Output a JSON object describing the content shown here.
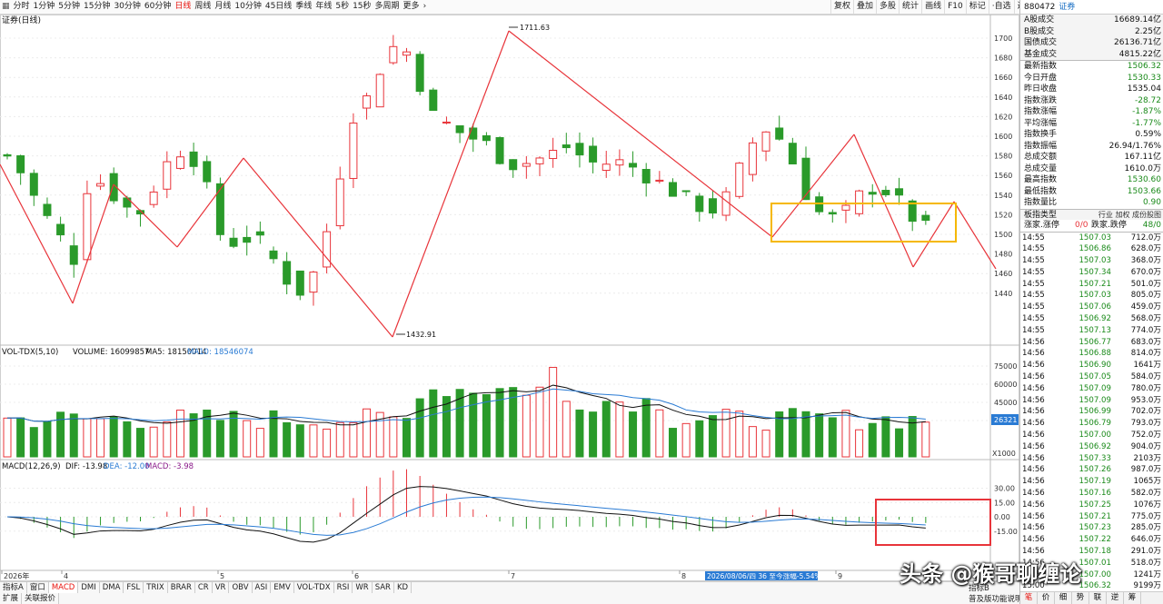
{
  "toolbar": {
    "grid_icon": "grid-icon",
    "periods": [
      "分时",
      "1分钟",
      "5分钟",
      "15分钟",
      "30分钟",
      "60分钟",
      "日线",
      "周线",
      "月线",
      "10分钟",
      "45日线",
      "季线",
      "年线",
      "5秒",
      "15秒",
      "多周期",
      "更多"
    ],
    "active_period": "日线",
    "more_arrow": "›",
    "tools": [
      "复权",
      "叠加",
      "多股",
      "统计",
      "画线",
      "F10",
      "标记",
      "·自选",
      "返回"
    ]
  },
  "chart": {
    "title": "证券(日线)",
    "price_ticks": [
      "1700",
      "1680",
      "1660",
      "1640",
      "1620",
      "1600",
      "1580",
      "1560",
      "1540",
      "1520",
      "1500",
      "1480",
      "1460",
      "1440"
    ],
    "high_label": "1711.63",
    "low_label": "1432.91",
    "vol_header": {
      "name": "VOL-TDX(5,10)",
      "volume": "VOLUME: 16099857",
      "ma5": "MA5: 18150014",
      "ma10": "MA10: 18546074"
    },
    "vol_ticks": [
      "75000",
      "60000",
      "45000",
      "30000"
    ],
    "vol_badge": "26321",
    "vol_unit": "X1000",
    "macd_header": {
      "name": "MACD(12,26,9)",
      "dif": "DIF: -13.98",
      "dea": "DEA: -12.00",
      "macd": "MACD: -3.98"
    },
    "macd_ticks": [
      "30.00",
      "15.00",
      "0.00",
      "-15.00"
    ],
    "date_labels": [
      "2026年",
      "4",
      "5",
      "6",
      "7",
      "8",
      "9"
    ],
    "info_tip": "2026/08/06/四 36 至今涨幅-5.54%",
    "colors": {
      "up": "#e8343a",
      "down": "#2a9a2a",
      "arrow": "#e8343a",
      "box_yellow": "#f5b800",
      "box_red": "#e8343a",
      "ma5": "#111111",
      "ma10": "#2a7bd4"
    }
  },
  "right_panel": {
    "code": "880472",
    "name": "证券",
    "summary": [
      {
        "label": "A股成交",
        "value": "16689.14亿",
        "color": "#111"
      },
      {
        "label": "B股成交",
        "value": "2.25亿",
        "color": "#111"
      },
      {
        "label": "国债成交",
        "value": "26136.71亿",
        "color": "#111"
      },
      {
        "label": "基金成交",
        "value": "4815.22亿",
        "color": "#111"
      }
    ],
    "stats": [
      {
        "label": "最新指数",
        "value": "1506.32",
        "color": "#1a8a1a"
      },
      {
        "label": "今日开盘",
        "value": "1530.33",
        "color": "#1a8a1a"
      },
      {
        "label": "昨日收盘",
        "value": "1535.04",
        "color": "#111"
      },
      {
        "label": "指数涨跌",
        "value": "-28.72",
        "color": "#1a8a1a"
      },
      {
        "label": "指数涨幅",
        "value": "-1.87%",
        "color": "#1a8a1a"
      },
      {
        "label": "平均涨幅",
        "value": "-1.77%",
        "color": "#1a8a1a"
      },
      {
        "label": "指数换手",
        "value": "0.59%",
        "color": "#111"
      },
      {
        "label": "指数振幅",
        "value": "26.94/1.76%",
        "color": "#111"
      },
      {
        "label": "总成交额",
        "value": "167.11亿",
        "color": "#111"
      },
      {
        "label": "总成交量",
        "value": "1610.0万",
        "color": "#111"
      },
      {
        "label": "最高指数",
        "value": "1530.60",
        "color": "#1a8a1a"
      },
      {
        "label": "最低指数",
        "value": "1503.66",
        "color": "#1a8a1a"
      },
      {
        "label": "指数量比",
        "value": "0.90",
        "color": "#1a8a1a"
      }
    ],
    "type_row": {
      "label": "板指类型",
      "value": "行业 加权 成份股图"
    },
    "adv_row": {
      "label": "涨家.涨停",
      "v1": "0/0",
      "label2": "跌家.跌停",
      "v2": "48/0"
    },
    "ticks": [
      [
        "14:55",
        "1507.03",
        "712.0万"
      ],
      [
        "14:55",
        "1506.86",
        "628.0万"
      ],
      [
        "14:55",
        "1507.03",
        "368.0万"
      ],
      [
        "14:55",
        "1507.34",
        "670.0万"
      ],
      [
        "14:55",
        "1507.21",
        "501.0万"
      ],
      [
        "14:55",
        "1507.03",
        "805.0万"
      ],
      [
        "14:55",
        "1507.06",
        "459.0万"
      ],
      [
        "14:55",
        "1506.92",
        "568.0万"
      ],
      [
        "14:55",
        "1507.13",
        "774.0万"
      ],
      [
        "14:56",
        "1506.77",
        "683.0万"
      ],
      [
        "14:56",
        "1506.88",
        "814.0万"
      ],
      [
        "14:56",
        "1506.90",
        "1641万"
      ],
      [
        "14:56",
        "1507.05",
        "584.0万"
      ],
      [
        "14:56",
        "1507.09",
        "780.0万"
      ],
      [
        "14:56",
        "1507.09",
        "953.0万"
      ],
      [
        "14:56",
        "1506.99",
        "702.0万"
      ],
      [
        "14:56",
        "1506.79",
        "793.0万"
      ],
      [
        "14:56",
        "1507.00",
        "752.0万"
      ],
      [
        "14:56",
        "1506.92",
        "904.0万"
      ],
      [
        "14:56",
        "1507.33",
        "2103万"
      ],
      [
        "14:56",
        "1507.26",
        "987.0万"
      ],
      [
        "14:56",
        "1507.19",
        "1065万"
      ],
      [
        "14:56",
        "1507.16",
        "582.0万"
      ],
      [
        "14:56",
        "1507.25",
        "1076万"
      ],
      [
        "14:56",
        "1507.21",
        "775.0万"
      ],
      [
        "14:56",
        "1507.23",
        "285.0万"
      ],
      [
        "14:56",
        "1507.22",
        "646.0万"
      ],
      [
        "14:56",
        "1507.18",
        "291.0万"
      ],
      [
        "14:56",
        "1507.01",
        "518.0万"
      ],
      [
        "14:56",
        "1507.00",
        "1241万"
      ],
      [
        "15:00",
        "1506.32",
        "9199万"
      ]
    ],
    "bottom_tabs": [
      "笔",
      "价",
      "细",
      "势",
      "联",
      "逆",
      "筹"
    ],
    "active_bottom": "笔"
  },
  "bottom": {
    "indicator_tabs": [
      "指标A",
      "窗口",
      "MACD",
      "DMI",
      "DMA",
      "FSL",
      "TRIX",
      "BRAR",
      "CR",
      "VR",
      "OBV",
      "ASI",
      "EMV",
      "VOL-TDX",
      "RSI",
      "WR",
      "SAR",
      "KD"
    ],
    "active_indicator": "MACD",
    "row2": [
      "扩展",
      "关联报价"
    ],
    "index_b": "指标B",
    "hint": "普及版功能说明"
  },
  "watermark": "头条 @猴哥聊缠论"
}
